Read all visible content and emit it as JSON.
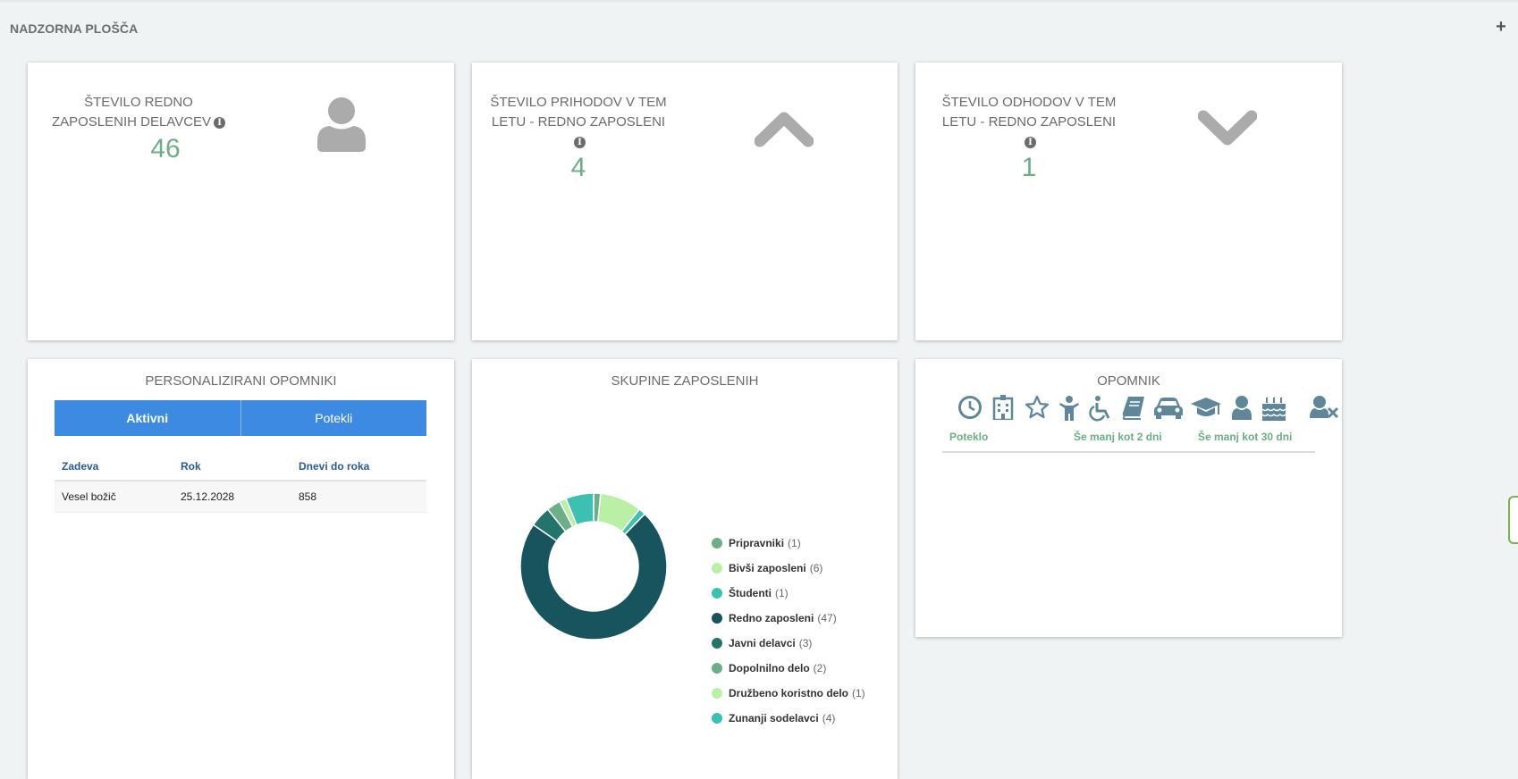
{
  "page": {
    "title": "NADZORNA PLOŠČA",
    "add_label": "+"
  },
  "kpis": [
    {
      "title_line1": "ŠTEVILO REDNO",
      "title_line2": "ZAPOSLENIH DELAVCEV",
      "value": "46",
      "icon": "user-icon"
    },
    {
      "title_line1": "ŠTEVILO PRIHODOV V TEM",
      "title_line2": "LETU - REDNO ZAPOSLENI",
      "value": "4",
      "icon": "chevron-up-icon"
    },
    {
      "title_line1": "ŠTEVILO ODHODOV V TEM",
      "title_line2": "LETU - REDNO ZAPOSLENI",
      "value": "1",
      "icon": "chevron-down-icon"
    }
  ],
  "reminders": {
    "title": "PERSONALIZIRANI OPOMNIKI",
    "tabs": [
      "Aktivni",
      "Potekli"
    ],
    "columns": [
      "Zadeva",
      "Rok",
      "Dnevi do roka"
    ],
    "rows": [
      {
        "subject": "Vesel božič",
        "deadline": "25.12.2028",
        "days": "858"
      }
    ]
  },
  "groups": {
    "title": "SKUPINE ZAPOSLENIH"
  },
  "chart_data": {
    "type": "pie",
    "donut": true,
    "categories": [
      "Pripravniki",
      "Bivši zaposleni",
      "Študenti",
      "Redno zaposleni",
      "Javni delavci",
      "Dopolnilno delo",
      "Družbeno koristno delo",
      "Zunanji sodelavci"
    ],
    "values": [
      1,
      6,
      1,
      47,
      3,
      2,
      1,
      4
    ],
    "colors": [
      "#6cae87",
      "#b9f0a6",
      "#3dbfb1",
      "#17545e",
      "#23756c",
      "#6cae87",
      "#b9f0a6",
      "#3dbfb1"
    ],
    "legend_position": "right"
  },
  "opomnik": {
    "title": "OPOMNIK",
    "icons": [
      "clock-icon",
      "hospital-icon",
      "star-icon",
      "child-icon",
      "wheelchair-icon",
      "book-icon",
      "car-icon",
      "graduation-cap-icon",
      "user-icon",
      "birthday-cake-icon",
      "user-remove-icon"
    ],
    "labels": [
      "Poteklo",
      "Še manj kot 2 dni",
      "Še manj kot 30 dni"
    ],
    "colors": {
      "icon": "#5f8799",
      "label": "#6cae87"
    }
  }
}
